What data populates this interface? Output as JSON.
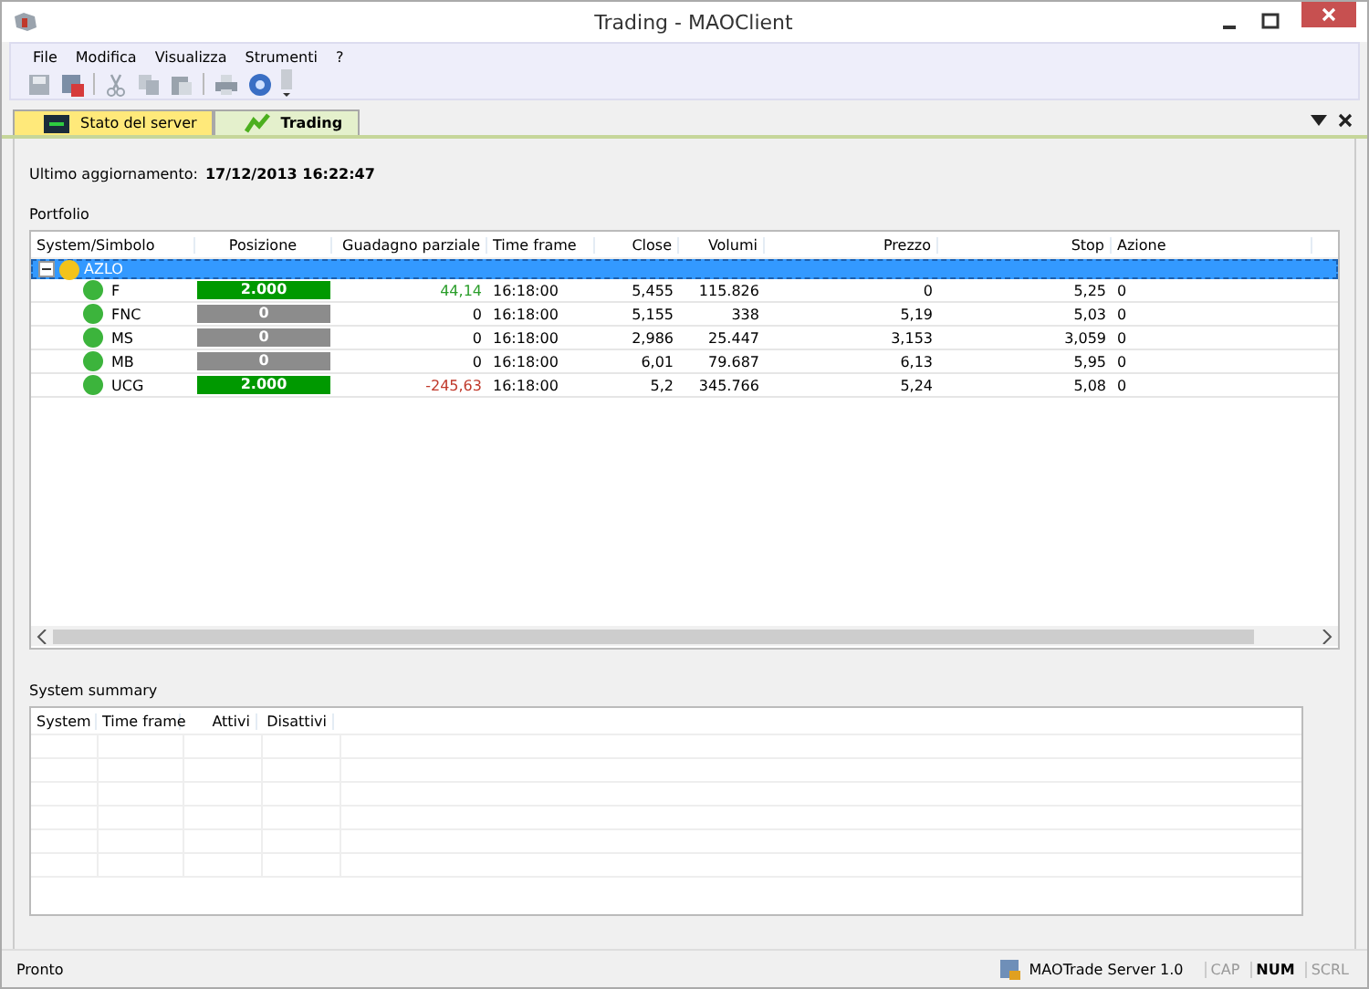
{
  "window": {
    "title": "Trading - MAOClient"
  },
  "menu": [
    "File",
    "Modifica",
    "Visualizza",
    "Strumenti",
    "?"
  ],
  "tabs": [
    {
      "label": "Stato del server",
      "selected": false
    },
    {
      "label": "Trading",
      "selected": true
    }
  ],
  "last_update": {
    "label": "Ultimo aggiornamento:",
    "value": "17/12/2013 16:22:47"
  },
  "portfolio": {
    "title": "Portfolio",
    "columns": [
      "System/Simbolo",
      "Posizione",
      "Guadagno parziale",
      "Time frame",
      "Close",
      "Volumi",
      "Prezzo",
      "Stop",
      "Azione"
    ],
    "systems": [
      {
        "name": "AZLO",
        "expanded": true,
        "selected": true,
        "children": [
          {
            "symbol": "F",
            "position": {
              "text": "2.000",
              "color": "#009900"
            },
            "gain": {
              "text": "44,14",
              "color": "#2a9d2a"
            },
            "time_frame": "16:18:00",
            "close": "5,455",
            "volumes": "115.826",
            "price": "0",
            "stop": "5,25",
            "action": "0"
          },
          {
            "symbol": "FNC",
            "position": {
              "text": "0",
              "color": "#8c8c8c"
            },
            "gain": {
              "text": "0",
              "color": "#000000"
            },
            "time_frame": "16:18:00",
            "close": "5,155",
            "volumes": "338",
            "price": "5,19",
            "stop": "5,03",
            "action": "0"
          },
          {
            "symbol": "MS",
            "position": {
              "text": "0",
              "color": "#8c8c8c"
            },
            "gain": {
              "text": "0",
              "color": "#000000"
            },
            "time_frame": "16:18:00",
            "close": "2,986",
            "volumes": "25.447",
            "price": "3,153",
            "stop": "3,059",
            "action": "0"
          },
          {
            "symbol": "MB",
            "position": {
              "text": "0",
              "color": "#8c8c8c"
            },
            "gain": {
              "text": "0",
              "color": "#000000"
            },
            "time_frame": "16:18:00",
            "close": "6,01",
            "volumes": "79.687",
            "price": "6,13",
            "stop": "5,95",
            "action": "0"
          },
          {
            "symbol": "UCG",
            "position": {
              "text": "2.000",
              "color": "#009900"
            },
            "gain": {
              "text": "-245,63",
              "color": "#c0392b"
            },
            "time_frame": "16:18:00",
            "close": "5,2",
            "volumes": "345.766",
            "price": "5,24",
            "stop": "5,08",
            "action": "0"
          }
        ]
      }
    ]
  },
  "summary": {
    "title": "System summary",
    "columns": [
      "System",
      "Time frame",
      "Attivi",
      "Disattivi"
    ]
  },
  "status_bar": {
    "text": "Pronto",
    "server": "MAOTrade Server 1.0",
    "indicators": [
      {
        "label": "CAP",
        "on": false
      },
      {
        "label": "NUM",
        "on": true
      },
      {
        "label": "SCRL",
        "on": false
      }
    ]
  }
}
